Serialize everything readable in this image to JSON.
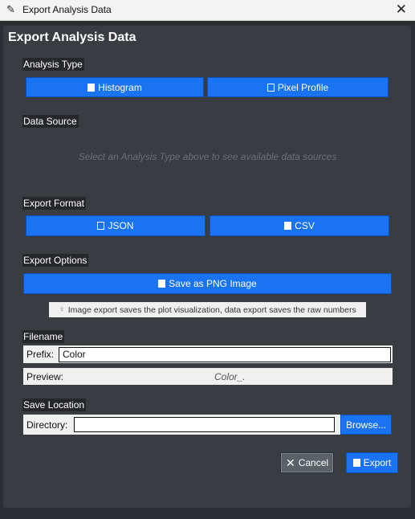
{
  "window": {
    "title": "Export Analysis Data"
  },
  "heading": "Export Analysis Data",
  "analysis_type": {
    "label": "Analysis Type",
    "buttons": [
      {
        "label": "Histogram",
        "icon": "save-icon"
      },
      {
        "label": "Pixel Profile",
        "icon": "image-icon"
      }
    ]
  },
  "data_source": {
    "label": "Data Source",
    "placeholder": "Select an Analysis Type above to see available data sources"
  },
  "export_format": {
    "label": "Export Format",
    "buttons": [
      {
        "label": "JSON",
        "icon": "document-icon"
      },
      {
        "label": "CSV",
        "icon": "save-icon"
      }
    ]
  },
  "export_options": {
    "label": "Export Options",
    "png_button": "Save as PNG Image",
    "hint": "Image export saves the plot visualization, data export saves the raw numbers"
  },
  "filename": {
    "label": "Filename",
    "prefix_label": "Prefix:",
    "prefix_value": "Color",
    "preview_label": "Preview:",
    "preview_value": "Color_."
  },
  "save_location": {
    "label": "Save Location",
    "directory_label": "Directory:",
    "directory_value": "",
    "browse_label": "Browse..."
  },
  "actions": {
    "cancel_label": "Cancel",
    "export_label": "Export"
  },
  "colors": {
    "accent": "#1a73f0",
    "panel": "#393c41",
    "background": "#2b2e33"
  }
}
